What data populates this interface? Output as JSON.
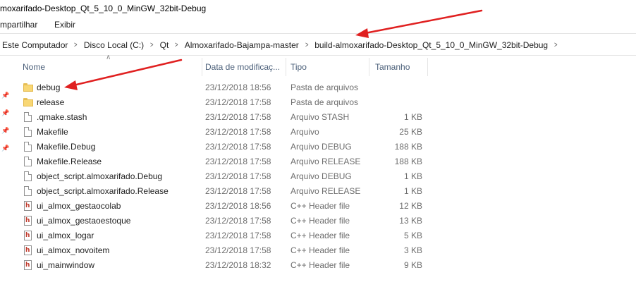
{
  "window": {
    "title": "moxarifado-Desktop_Qt_5_10_0_MinGW_32bit-Debug"
  },
  "ribbon": {
    "tabs": [
      "mpartilhar",
      "Exibir"
    ]
  },
  "address": {
    "crumbs": [
      "Este Computador",
      "Disco Local (C:)",
      "Qt",
      "Almoxarifado-Bajampa-master",
      "build-almoxarifado-Desktop_Qt_5_10_0_MinGW_32bit-Debug"
    ]
  },
  "columns": {
    "name": "Nome",
    "date": "Data de modificaç...",
    "type": "Tipo",
    "size": "Tamanho"
  },
  "files": [
    {
      "name": "debug",
      "date": "23/12/2018 18:56",
      "type": "Pasta de arquivos",
      "size": "",
      "icon": "folder-icon"
    },
    {
      "name": "release",
      "date": "23/12/2018 17:58",
      "type": "Pasta de arquivos",
      "size": "",
      "icon": "folder-icon"
    },
    {
      "name": ".qmake.stash",
      "date": "23/12/2018 17:58",
      "type": "Arquivo STASH",
      "size": "1 KB",
      "icon": "file-icon"
    },
    {
      "name": "Makefile",
      "date": "23/12/2018 17:58",
      "type": "Arquivo",
      "size": "25 KB",
      "icon": "file-icon"
    },
    {
      "name": "Makefile.Debug",
      "date": "23/12/2018 17:58",
      "type": "Arquivo DEBUG",
      "size": "188 KB",
      "icon": "file-icon"
    },
    {
      "name": "Makefile.Release",
      "date": "23/12/2018 17:58",
      "type": "Arquivo RELEASE",
      "size": "188 KB",
      "icon": "file-icon"
    },
    {
      "name": "object_script.almoxarifado.Debug",
      "date": "23/12/2018 17:58",
      "type": "Arquivo DEBUG",
      "size": "1 KB",
      "icon": "file-icon"
    },
    {
      "name": "object_script.almoxarifado.Release",
      "date": "23/12/2018 17:58",
      "type": "Arquivo RELEASE",
      "size": "1 KB",
      "icon": "file-icon"
    },
    {
      "name": "ui_almox_gestaocolab",
      "date": "23/12/2018 18:56",
      "type": "C++ Header file",
      "size": "12 KB",
      "icon": "cpp-header-icon"
    },
    {
      "name": "ui_almox_gestaoestoque",
      "date": "23/12/2018 17:58",
      "type": "C++ Header file",
      "size": "13 KB",
      "icon": "cpp-header-icon"
    },
    {
      "name": "ui_almox_logar",
      "date": "23/12/2018 17:58",
      "type": "C++ Header file",
      "size": "5 KB",
      "icon": "cpp-header-icon"
    },
    {
      "name": "ui_almox_novoitem",
      "date": "23/12/2018 17:58",
      "type": "C++ Header file",
      "size": "3 KB",
      "icon": "cpp-header-icon"
    },
    {
      "name": "ui_mainwindow",
      "date": "23/12/2018 18:32",
      "type": "C++ Header file",
      "size": "9 KB",
      "icon": "cpp-header-icon"
    }
  ],
  "colors": {
    "annotation_arrow": "#e02020",
    "header_text": "#4c607a",
    "folder": "#f8d775"
  }
}
